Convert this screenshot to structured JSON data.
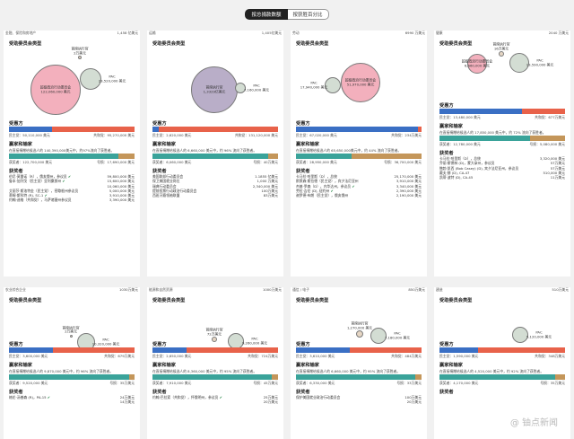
{
  "tabs": {
    "active": "按总捐款数额",
    "second": "按获胜百分比"
  },
  "labels": {
    "committee_type": "受助委员会类型",
    "recipients": "受惠方",
    "winners_losers": "赢家和输家",
    "winners": "获奖者",
    "super_pac": "超级政治行动委员会",
    "leadership_pac": "首席执行官",
    "pac": "PAC",
    "dem_prefix": "民主党：",
    "rep_prefix": "共和党：",
    "winner_prefix": "获奖者：",
    "loser_prefix": "输家：",
    "loss_prefix": "亏损：",
    "loss_short_prefix": "号损："
  },
  "colors": {
    "dem": "#3a6fc4",
    "rep": "#e8624a",
    "win": "#3aa39a",
    "lose": "#c4965a",
    "super": "#f3b0bd",
    "leader": "#e6d6c4",
    "pac": "#d3ddd3",
    "bubble_edge": "#7a7a7a"
  },
  "watermark": "@ 铀点新闻",
  "cards": [
    {
      "industry": "金融、保险和房地产",
      "total": "1,458 亿美元",
      "super_amt": "122,060,000 美元",
      "leader_amt": "2万美元",
      "pac_amt": "23,520,000 美元",
      "dem_amt": "50,110,000 美元",
      "rep_amt": "95,270,000 美元",
      "dem_share": 0.34,
      "wl_text": "在直接捐赠给候选人的 140,390,000美元中，约97%流向了获胜者。",
      "winner_amt": "122,700,000 美元",
      "loser_amt": "17,690,000 美元",
      "win_share": 0.87,
      "winners_list": [
        {
          "name": "伯尼·莫雷诺（R），俄亥俄州，参议员",
          "amt": "59,800,000 美元",
          "check": true
        },
        {
          "name": "鲁本·加列戈（民主党）亚利桑那州",
          "amt": "15,600,000 美元",
          "check": true
        },
        {
          "name": "",
          "amt": "10,060,000 美元",
          "check": false
        },
        {
          "name": "艾丽莎·斯洛特金（民主党），密歇根州参议员",
          "amt": "5,000,000 美元",
          "check": false
        },
        {
          "name": "蒂姆·斯科特 (R), SC-1",
          "amt": "3,910,000 美元",
          "check": true
        },
        {
          "name": "约翰·迪格（共和党），马萨诸塞州参议员",
          "amt": "3,390,000 美元",
          "check": false
        }
      ]
    },
    {
      "industry": "运输",
      "total": "1,405亿美元",
      "super_amt": "",
      "leader_amt": "1,3329亿美元",
      "pac_amt": "7,160,000 美元",
      "dem_amt": "2,620,000 美元",
      "rep_amt": "131,120,000 美元",
      "dem_share": 0.05,
      "wl_text": "在直接捐赠给候选人的 6,660,000 美元中，约 96% 流向了获胜者。",
      "winner_amt": "6,060,000 美元",
      "loser_amt": "40万美元",
      "win_share": 0.92,
      "winners_list": [
        {
          "name": "美国联邦行动委员会",
          "amt": "1.1855 亿美元",
          "check": false
        },
        {
          "name": "保卫美国就业岗位",
          "amt": "1,000 万美元",
          "check": false
        },
        {
          "name": "瑞典行动委员会",
          "amt": "2,340,000 美元",
          "check": false
        },
        {
          "name": "提前投票行动政治行动委员会",
          "amt": "100万美元",
          "check": false
        },
        {
          "name": "西班牙裔领袖联盟",
          "amt": "83万美元",
          "check": false
        }
      ]
    },
    {
      "industry": "劳动",
      "total": "6990 万美元",
      "super_amt": "51,970,000 美元",
      "leader_amt": "",
      "pac_amt": "17,940,000 美元",
      "dem_amt": "67,020,000 美元",
      "rep_amt": "234万美元",
      "dem_share": 0.97,
      "wl_text": "在直接捐赠给候选人的 65,650,000美元中，约 44% 流向了获胜者。",
      "winner_amt": "28,950,000 美元",
      "loser_amt": "36,700,000 美元",
      "win_share": 0.44,
      "winners_list": [
        {
          "name": "卡马拉·哈里斯（D），总统",
          "amt": "25,170,000 美元",
          "check": false
        },
        {
          "name": "斯莱森·斯拉德（民主党），宾夕法尼亚州",
          "amt": "3,910,000 美元",
          "check": false
        },
        {
          "name": "杰基·罗森（D），内华达州，参议员",
          "amt": "3,340,000 美元",
          "check": true
        },
        {
          "name": "劳拉·吉伦 (D), 纽约州",
          "amt": "2,390,000 美元",
          "check": true
        },
        {
          "name": "谢罗德·布朗（民主党），俄亥俄州",
          "amt": "2,190,000 美元",
          "check": false
        }
      ]
    },
    {
      "industry": "健康",
      "total": "2040 万美元",
      "super_amt": "6,660,000 美元",
      "leader_amt": "16万美元",
      "pac_amt": "13,590,000 美元",
      "dem_amt": "13,480,000 美元",
      "rep_amt": "677万美元",
      "dem_share": 0.66,
      "wl_text": "在直接捐赠给候选人的 17,850,000 美元中，约 72% 流向了获胜者。",
      "winner_amt": "12,780,000 美元",
      "loser_amt": "5,080,000 美元",
      "win_share": 0.72,
      "winners_list": [
        {
          "name": "卡马拉·哈里斯（D），总统",
          "amt": "3,320,000 美元",
          "check": false
        },
        {
          "name": "乔丽·斯德林 (D)，蒙大拿州，参议员",
          "amt": "57万美元",
          "check": false
        },
        {
          "name": "鲍勃·凯西 (Bob Casey) (D), 宾夕法尼亚州，参议员",
          "amt": "57万美元",
          "check": false
        },
        {
          "name": "戴夫·赫 (D), CA-47",
          "amt": "510,000 美元",
          "check": false
        },
        {
          "name": "凯蒂·波特 (D), CA-45",
          "amt": "11万美元",
          "check": false
        }
      ]
    },
    {
      "industry": "农业综合企业",
      "total": "1030万美元",
      "super_amt": "",
      "leader_amt": "2万美元",
      "pac_amt": "10,320,000 美元",
      "dem_amt": "3,600,000 美元",
      "rep_amt": "679万美元",
      "dem_share": 0.35,
      "wl_text": "在直接捐赠给候选人的 9,870,000 美元中，约 96% 流向了获胜者。",
      "winner_amt": "9,520,000 美元",
      "loser_amt": "35万美元",
      "win_share": 0.96,
      "winners_list": [
        {
          "name": "格伦·汤普森 (R)，PA-15",
          "amt": "24万美元",
          "check": true
        },
        {
          "name": "",
          "amt": "14万美元",
          "check": false
        }
      ]
    },
    {
      "industry": "能源和自然资源",
      "total": "1000万美元",
      "super_amt": "",
      "leader_amt": "72万美元",
      "pac_amt": "9,260,000 美元",
      "dem_amt": "2,650,000 美元",
      "rep_amt": "724万美元",
      "dem_share": 0.27,
      "wl_text": "在直接捐赠给候选人的 8,360,000 美元中，约 95% 流向了获胜者。",
      "winner_amt": "7,910,000 美元",
      "loser_amt": "45万美元",
      "win_share": 0.95,
      "winners_list": [
        {
          "name": "约翰·巴拉索（共和党），怀俄明州，参议员",
          "amt": "25万美元",
          "check": true
        },
        {
          "name": "",
          "amt": "20万美元",
          "check": false
        }
      ]
    },
    {
      "industry": "通信 / 电子",
      "total": "850万美元",
      "super_amt": "",
      "leader_amt": "1,270,000 美元",
      "pac_amt": "7,180,000 美元",
      "dem_amt": "3,610,000 美元",
      "rep_amt": "484万美元",
      "dem_share": 0.43,
      "wl_text": "在直接捐赠给候选人的 6,660,000 美元中，约 95% 流向了获胜者。",
      "winner_amt": "6,330,000 美元",
      "loser_amt": "33万美元",
      "win_share": 0.95,
      "winners_list": [
        {
          "name": "保护美国就业政治行动委员会",
          "amt": "100万美元",
          "check": false
        },
        {
          "name": "",
          "amt": "20万美元",
          "check": false
        }
      ]
    },
    {
      "industry": "建造",
      "total": "510万美元",
      "super_amt": "",
      "leader_amt": "",
      "pac_amt": "5,120,000 美元",
      "dem_amt": "1,590,000 美元",
      "rep_amt": "348万美元",
      "dem_share": 0.31,
      "wl_text": "在直接捐赠给候选人的 4,520,000 美元中，约 92% 流向了获胜者。",
      "winner_amt": "4,170,000 美元",
      "loser_amt": "35万美元",
      "win_share": 0.92,
      "winners_list": []
    }
  ]
}
